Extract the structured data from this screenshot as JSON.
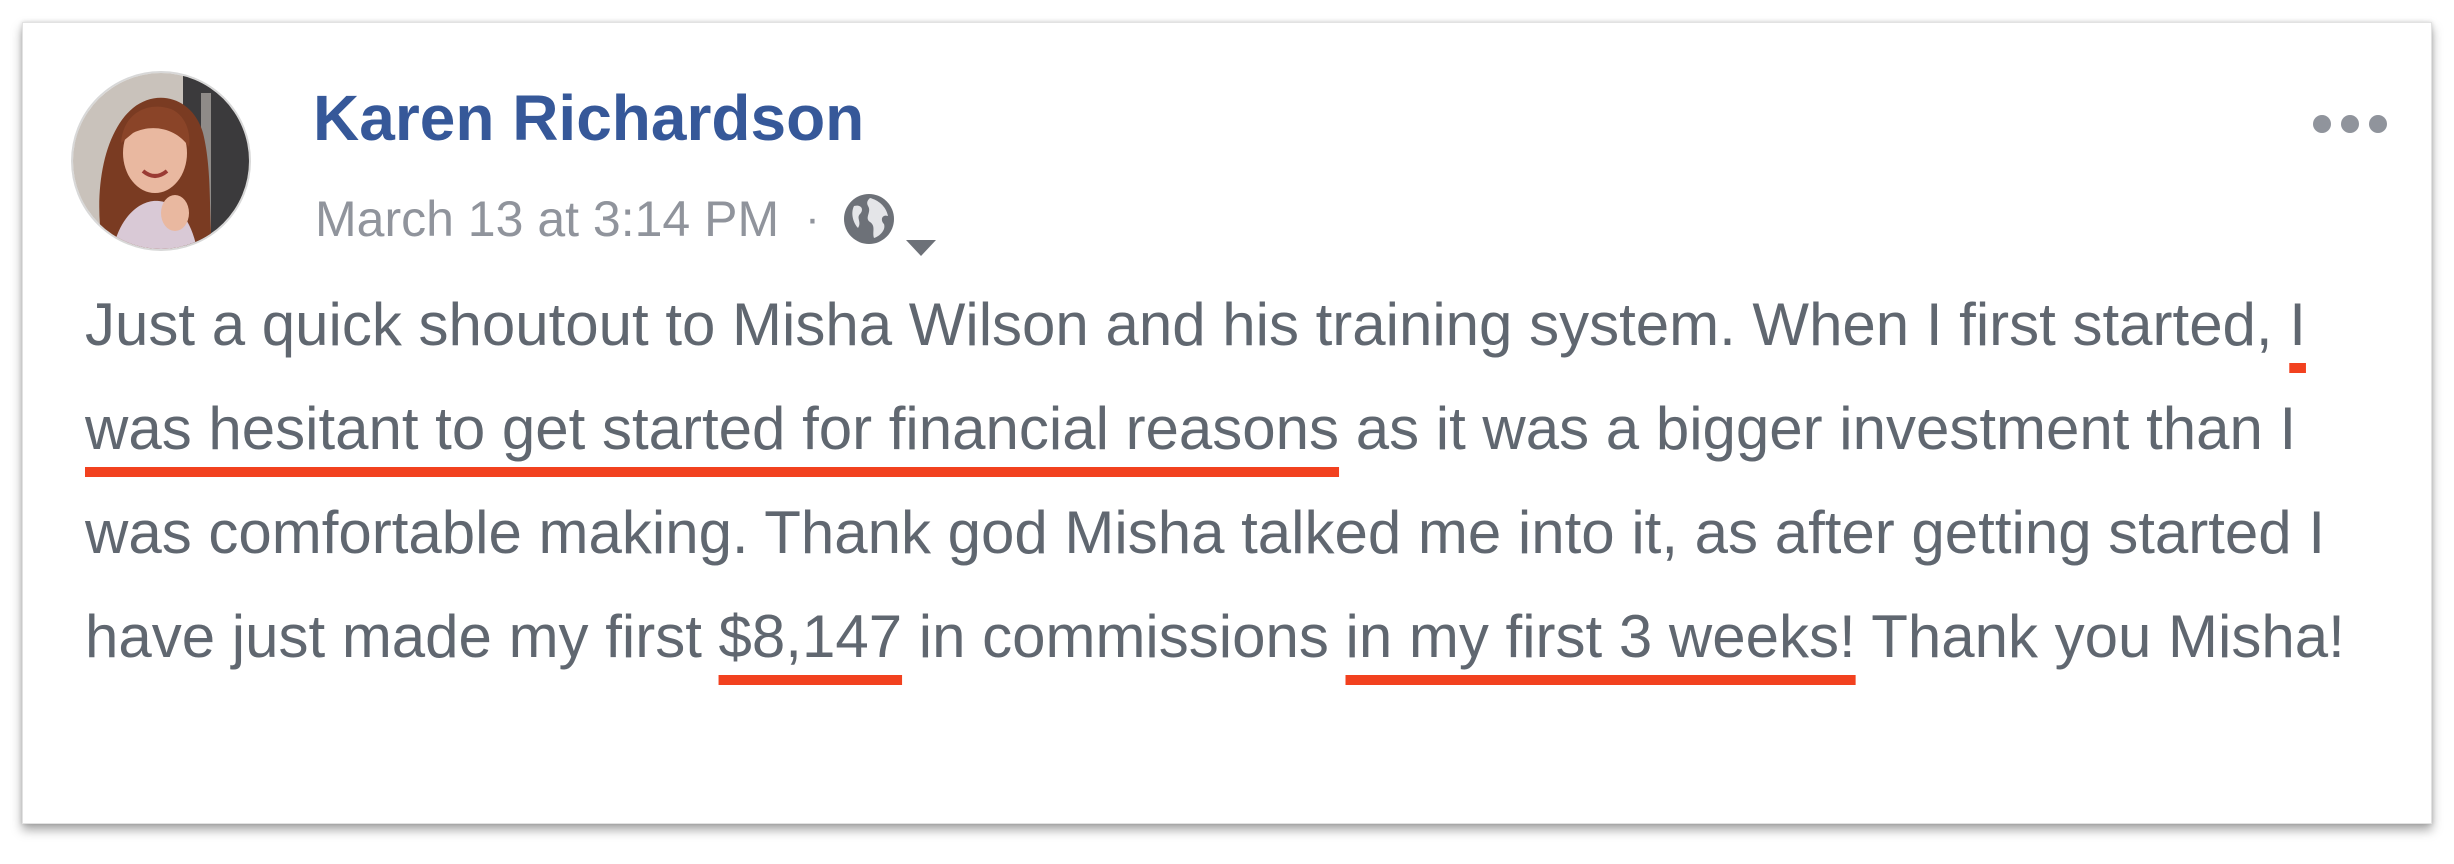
{
  "post": {
    "author": "Karen Richardson",
    "timestamp": "March 13 at 3:14 PM",
    "separator": "·",
    "privacy_icon": "globe-icon",
    "privacy_dropdown_icon": "chevron-down-icon",
    "more_options_icon": "more-horizontal-icon",
    "avatar_icon": "profile-photo",
    "body": {
      "part_1": "Just a quick shoutout to Misha Wilson and his training system. When I first started, ",
      "highlight_1": "I was hesitant to get started for financial reasons",
      "part_2": " as it was a bigger investment than I was comfortable making. Thank god Misha talked me into it, as after getting started I have just made my first ",
      "highlight_2": "$8,147",
      "part_3": " in commissions ",
      "highlight_3": "in my first 3 weeks!",
      "part_4": " Thank you Misha!"
    }
  },
  "colors": {
    "author_link": "#365899",
    "meta_text": "#90949c",
    "body_text": "#606770",
    "highlight_underline": "#f2411f"
  }
}
